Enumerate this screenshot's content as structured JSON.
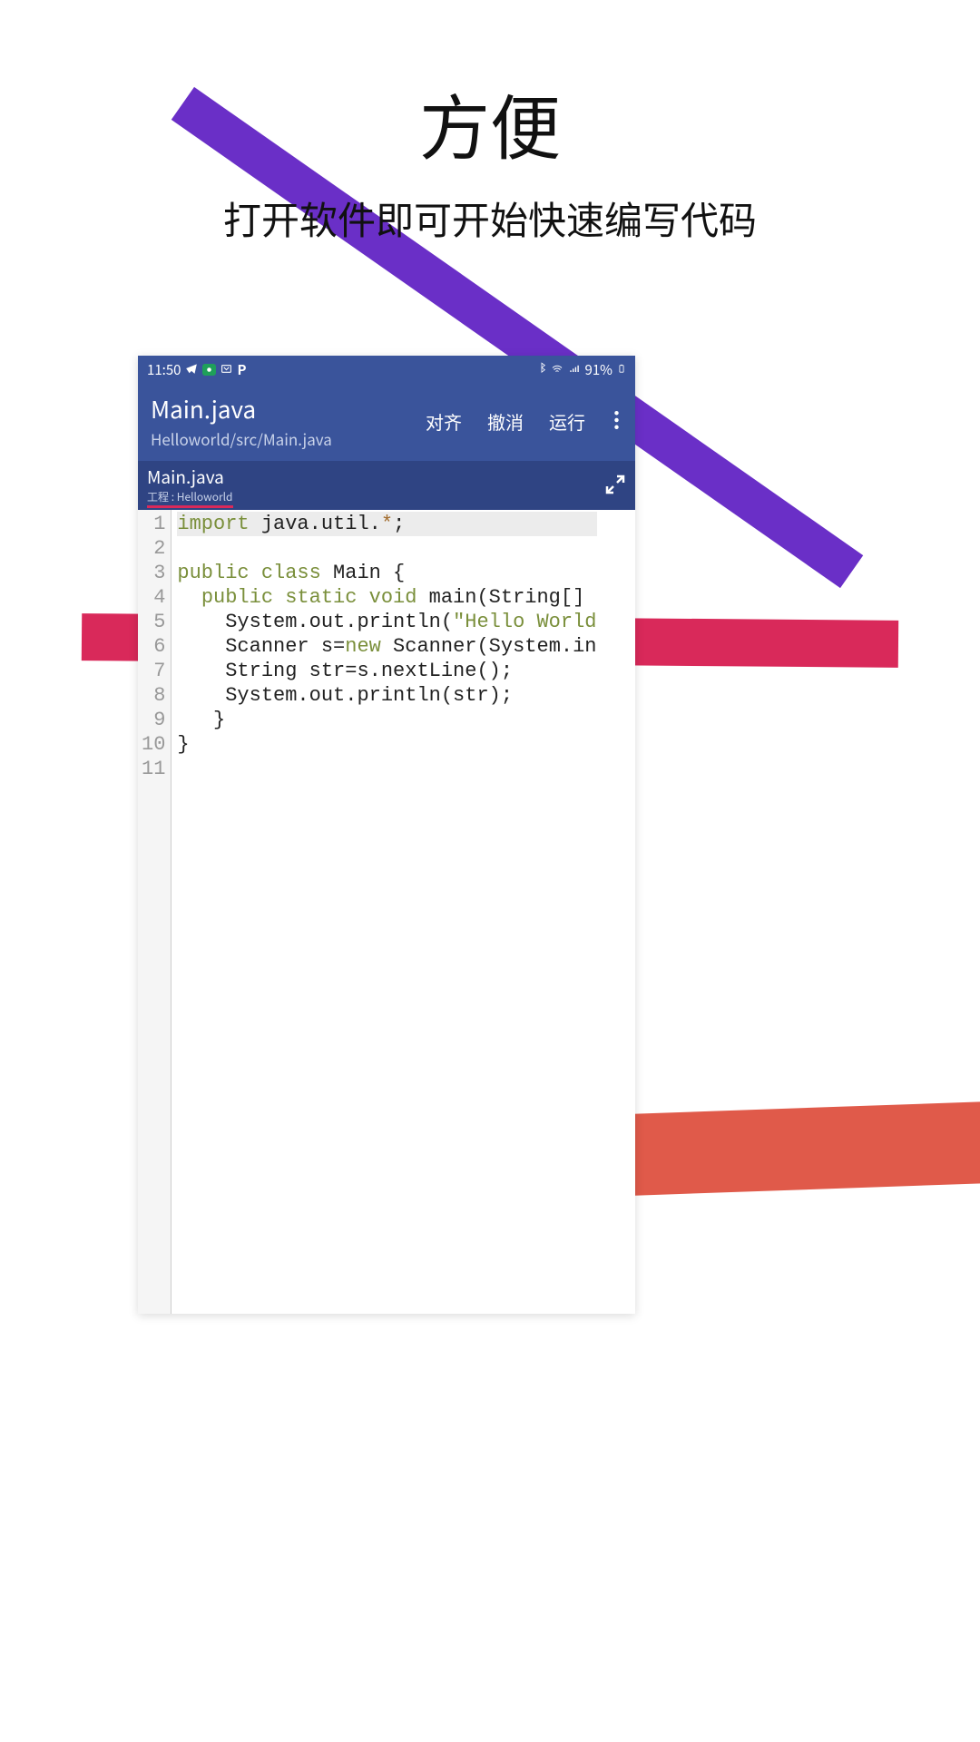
{
  "promo": {
    "title": "方便",
    "subtitle": "打开软件即可开始快速编写代码"
  },
  "statusBar": {
    "time": "11:50",
    "battery": "91%"
  },
  "appBar": {
    "title": "Main.java",
    "path": "Helloworld/src/Main.java",
    "actions": {
      "align": "对齐",
      "undo": "撤消",
      "run": "运行"
    }
  },
  "tab": {
    "name": "Main.java",
    "project": "工程 : Helloworld"
  },
  "code": {
    "lineNumbers": [
      "1",
      "2",
      "3",
      "4",
      "5",
      "6",
      "7",
      "8",
      "9",
      "10",
      "11"
    ],
    "lines": [
      [
        {
          "t": "import",
          "c": "kw"
        },
        {
          "t": " java.util."
        },
        {
          "t": "*",
          "c": "op"
        },
        {
          "t": ";"
        }
      ],
      [
        {
          "t": ""
        }
      ],
      [
        {
          "t": "public class",
          "c": "kw"
        },
        {
          "t": " Main {"
        }
      ],
      [
        {
          "t": "  "
        },
        {
          "t": "public static void",
          "c": "kw"
        },
        {
          "t": " main(String[]"
        }
      ],
      [
        {
          "t": "    System.out.println("
        },
        {
          "t": "\"Hello World",
          "c": "str"
        }
      ],
      [
        {
          "t": "    Scanner s="
        },
        {
          "t": "new",
          "c": "kw"
        },
        {
          "t": " Scanner(System.in"
        }
      ],
      [
        {
          "t": "    String str=s.nextLine();"
        }
      ],
      [
        {
          "t": "    System.out.println(str);"
        }
      ],
      [
        {
          "t": "   }"
        }
      ],
      [
        {
          "t": "}"
        }
      ],
      [
        {
          "t": ""
        }
      ]
    ]
  }
}
